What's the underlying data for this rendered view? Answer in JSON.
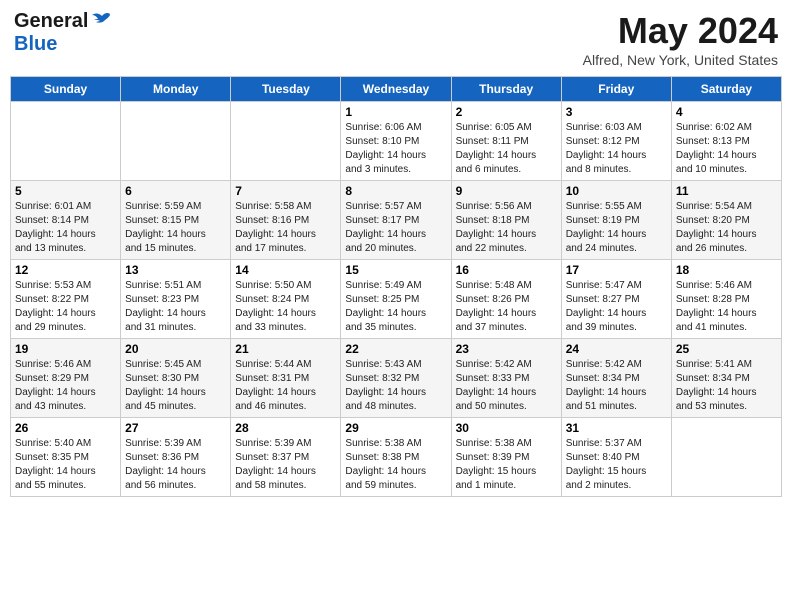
{
  "header": {
    "logo_general": "General",
    "logo_blue": "Blue",
    "title": "May 2024",
    "subtitle": "Alfred, New York, United States"
  },
  "weekdays": [
    "Sunday",
    "Monday",
    "Tuesday",
    "Wednesday",
    "Thursday",
    "Friday",
    "Saturday"
  ],
  "weeks": [
    [
      {
        "day": "",
        "info": ""
      },
      {
        "day": "",
        "info": ""
      },
      {
        "day": "",
        "info": ""
      },
      {
        "day": "1",
        "info": "Sunrise: 6:06 AM\nSunset: 8:10 PM\nDaylight: 14 hours\nand 3 minutes."
      },
      {
        "day": "2",
        "info": "Sunrise: 6:05 AM\nSunset: 8:11 PM\nDaylight: 14 hours\nand 6 minutes."
      },
      {
        "day": "3",
        "info": "Sunrise: 6:03 AM\nSunset: 8:12 PM\nDaylight: 14 hours\nand 8 minutes."
      },
      {
        "day": "4",
        "info": "Sunrise: 6:02 AM\nSunset: 8:13 PM\nDaylight: 14 hours\nand 10 minutes."
      }
    ],
    [
      {
        "day": "5",
        "info": "Sunrise: 6:01 AM\nSunset: 8:14 PM\nDaylight: 14 hours\nand 13 minutes."
      },
      {
        "day": "6",
        "info": "Sunrise: 5:59 AM\nSunset: 8:15 PM\nDaylight: 14 hours\nand 15 minutes."
      },
      {
        "day": "7",
        "info": "Sunrise: 5:58 AM\nSunset: 8:16 PM\nDaylight: 14 hours\nand 17 minutes."
      },
      {
        "day": "8",
        "info": "Sunrise: 5:57 AM\nSunset: 8:17 PM\nDaylight: 14 hours\nand 20 minutes."
      },
      {
        "day": "9",
        "info": "Sunrise: 5:56 AM\nSunset: 8:18 PM\nDaylight: 14 hours\nand 22 minutes."
      },
      {
        "day": "10",
        "info": "Sunrise: 5:55 AM\nSunset: 8:19 PM\nDaylight: 14 hours\nand 24 minutes."
      },
      {
        "day": "11",
        "info": "Sunrise: 5:54 AM\nSunset: 8:20 PM\nDaylight: 14 hours\nand 26 minutes."
      }
    ],
    [
      {
        "day": "12",
        "info": "Sunrise: 5:53 AM\nSunset: 8:22 PM\nDaylight: 14 hours\nand 29 minutes."
      },
      {
        "day": "13",
        "info": "Sunrise: 5:51 AM\nSunset: 8:23 PM\nDaylight: 14 hours\nand 31 minutes."
      },
      {
        "day": "14",
        "info": "Sunrise: 5:50 AM\nSunset: 8:24 PM\nDaylight: 14 hours\nand 33 minutes."
      },
      {
        "day": "15",
        "info": "Sunrise: 5:49 AM\nSunset: 8:25 PM\nDaylight: 14 hours\nand 35 minutes."
      },
      {
        "day": "16",
        "info": "Sunrise: 5:48 AM\nSunset: 8:26 PM\nDaylight: 14 hours\nand 37 minutes."
      },
      {
        "day": "17",
        "info": "Sunrise: 5:47 AM\nSunset: 8:27 PM\nDaylight: 14 hours\nand 39 minutes."
      },
      {
        "day": "18",
        "info": "Sunrise: 5:46 AM\nSunset: 8:28 PM\nDaylight: 14 hours\nand 41 minutes."
      }
    ],
    [
      {
        "day": "19",
        "info": "Sunrise: 5:46 AM\nSunset: 8:29 PM\nDaylight: 14 hours\nand 43 minutes."
      },
      {
        "day": "20",
        "info": "Sunrise: 5:45 AM\nSunset: 8:30 PM\nDaylight: 14 hours\nand 45 minutes."
      },
      {
        "day": "21",
        "info": "Sunrise: 5:44 AM\nSunset: 8:31 PM\nDaylight: 14 hours\nand 46 minutes."
      },
      {
        "day": "22",
        "info": "Sunrise: 5:43 AM\nSunset: 8:32 PM\nDaylight: 14 hours\nand 48 minutes."
      },
      {
        "day": "23",
        "info": "Sunrise: 5:42 AM\nSunset: 8:33 PM\nDaylight: 14 hours\nand 50 minutes."
      },
      {
        "day": "24",
        "info": "Sunrise: 5:42 AM\nSunset: 8:34 PM\nDaylight: 14 hours\nand 51 minutes."
      },
      {
        "day": "25",
        "info": "Sunrise: 5:41 AM\nSunset: 8:34 PM\nDaylight: 14 hours\nand 53 minutes."
      }
    ],
    [
      {
        "day": "26",
        "info": "Sunrise: 5:40 AM\nSunset: 8:35 PM\nDaylight: 14 hours\nand 55 minutes."
      },
      {
        "day": "27",
        "info": "Sunrise: 5:39 AM\nSunset: 8:36 PM\nDaylight: 14 hours\nand 56 minutes."
      },
      {
        "day": "28",
        "info": "Sunrise: 5:39 AM\nSunset: 8:37 PM\nDaylight: 14 hours\nand 58 minutes."
      },
      {
        "day": "29",
        "info": "Sunrise: 5:38 AM\nSunset: 8:38 PM\nDaylight: 14 hours\nand 59 minutes."
      },
      {
        "day": "30",
        "info": "Sunrise: 5:38 AM\nSunset: 8:39 PM\nDaylight: 15 hours\nand 1 minute."
      },
      {
        "day": "31",
        "info": "Sunrise: 5:37 AM\nSunset: 8:40 PM\nDaylight: 15 hours\nand 2 minutes."
      },
      {
        "day": "",
        "info": ""
      }
    ]
  ]
}
